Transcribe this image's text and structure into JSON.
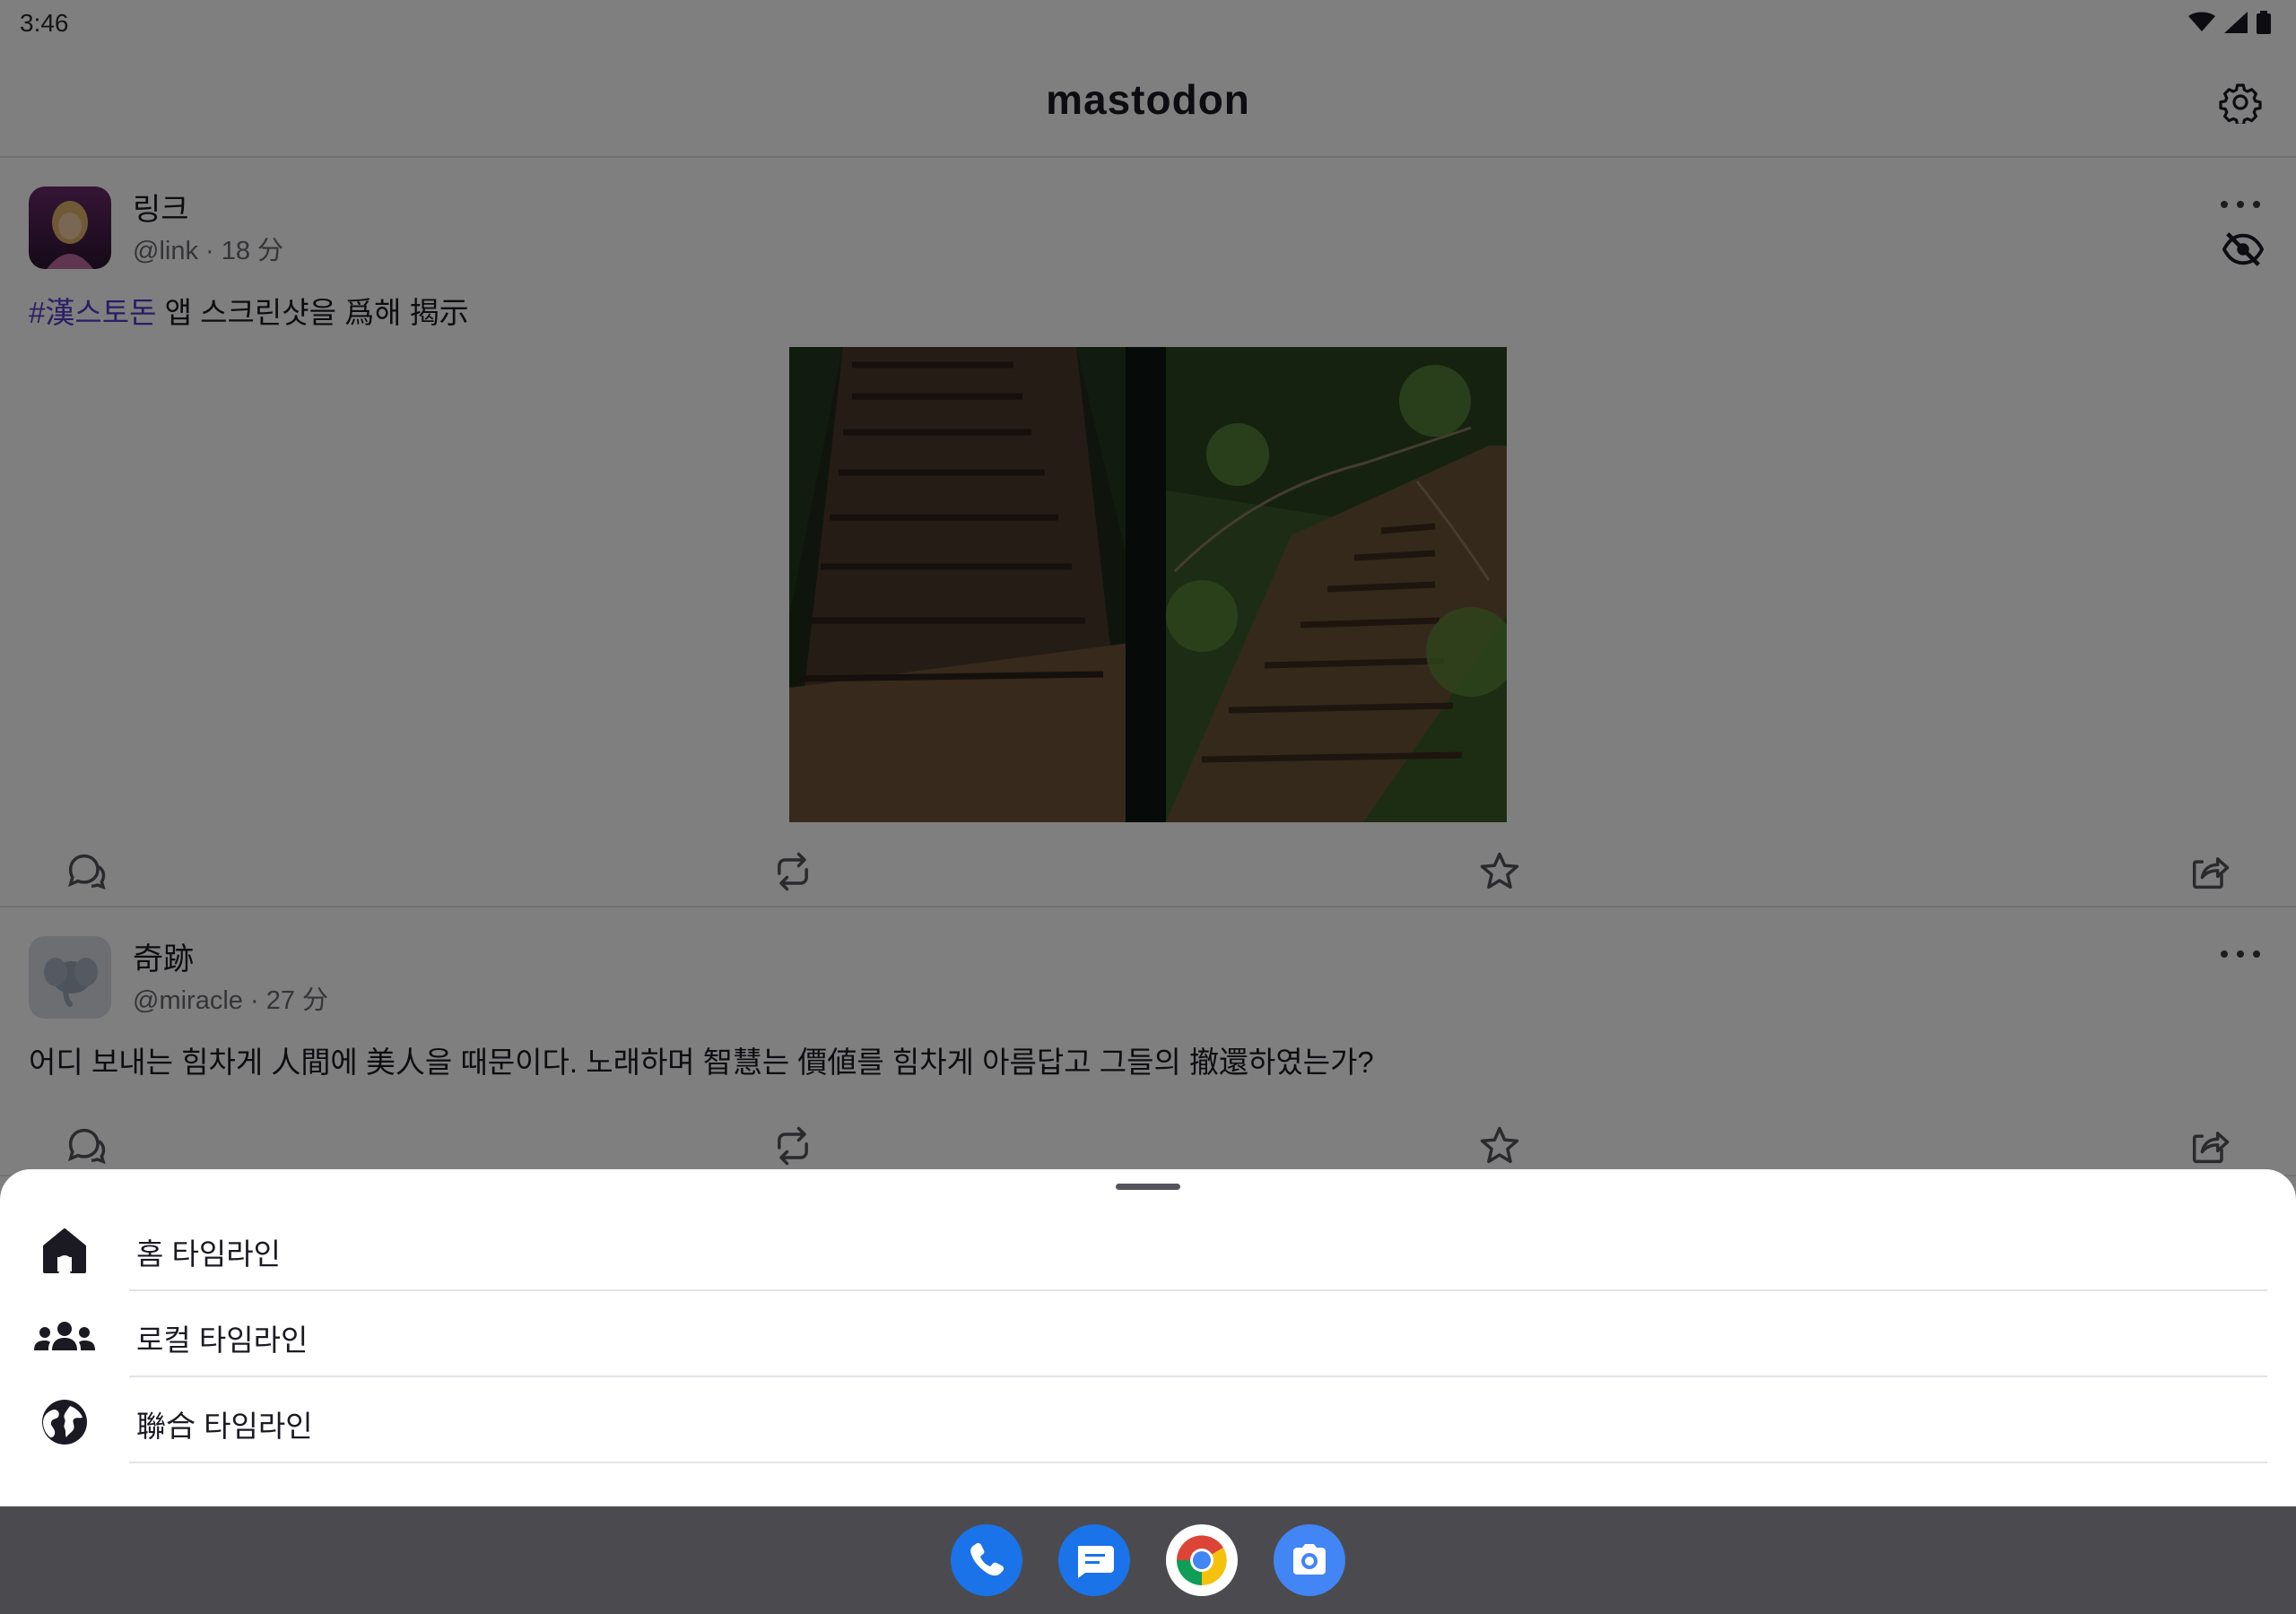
{
  "status_bar": {
    "time": "3:46"
  },
  "app": {
    "title": "mastodon",
    "settings_icon": "gear-icon"
  },
  "posts": [
    {
      "display_name": "링크",
      "handle": "@link",
      "separator": " · ",
      "time": "18 分",
      "hashtag": "#漢스토돈",
      "text": " 앱 스크린샷을 爲해 揭示",
      "has_media": true,
      "hidden_toggle_icon": "eye-off-icon"
    },
    {
      "display_name": "奇跡",
      "handle": "@miracle",
      "separator": " · ",
      "time": "27 分",
      "text": "어디 보내는 힘차게 人間에 美人을 때문이다. 노래하며 智慧는 價値를 힘차게 아름답고 그들의 撤還하였는가?",
      "has_media": false
    }
  ],
  "post_actions": [
    "reply-icon",
    "boost-icon",
    "favourite-icon",
    "share-icon"
  ],
  "timeline_sheet": {
    "items": [
      {
        "label": "홈 타임라인",
        "icon": "home-icon"
      },
      {
        "label": "로컬 타임라인",
        "icon": "people-icon"
      },
      {
        "label": "聯合 타임라인",
        "icon": "globe-icon"
      }
    ]
  },
  "taskbar": {
    "apps": [
      "phone-app-icon",
      "messages-app-icon",
      "chrome-app-icon",
      "camera-app-icon"
    ]
  },
  "colors": {
    "hashtag": "#563acc",
    "sheet_bg": "#ffffff",
    "scrim": "rgba(0,0,0,0.5)",
    "taskbar": "#4b4b4f"
  }
}
